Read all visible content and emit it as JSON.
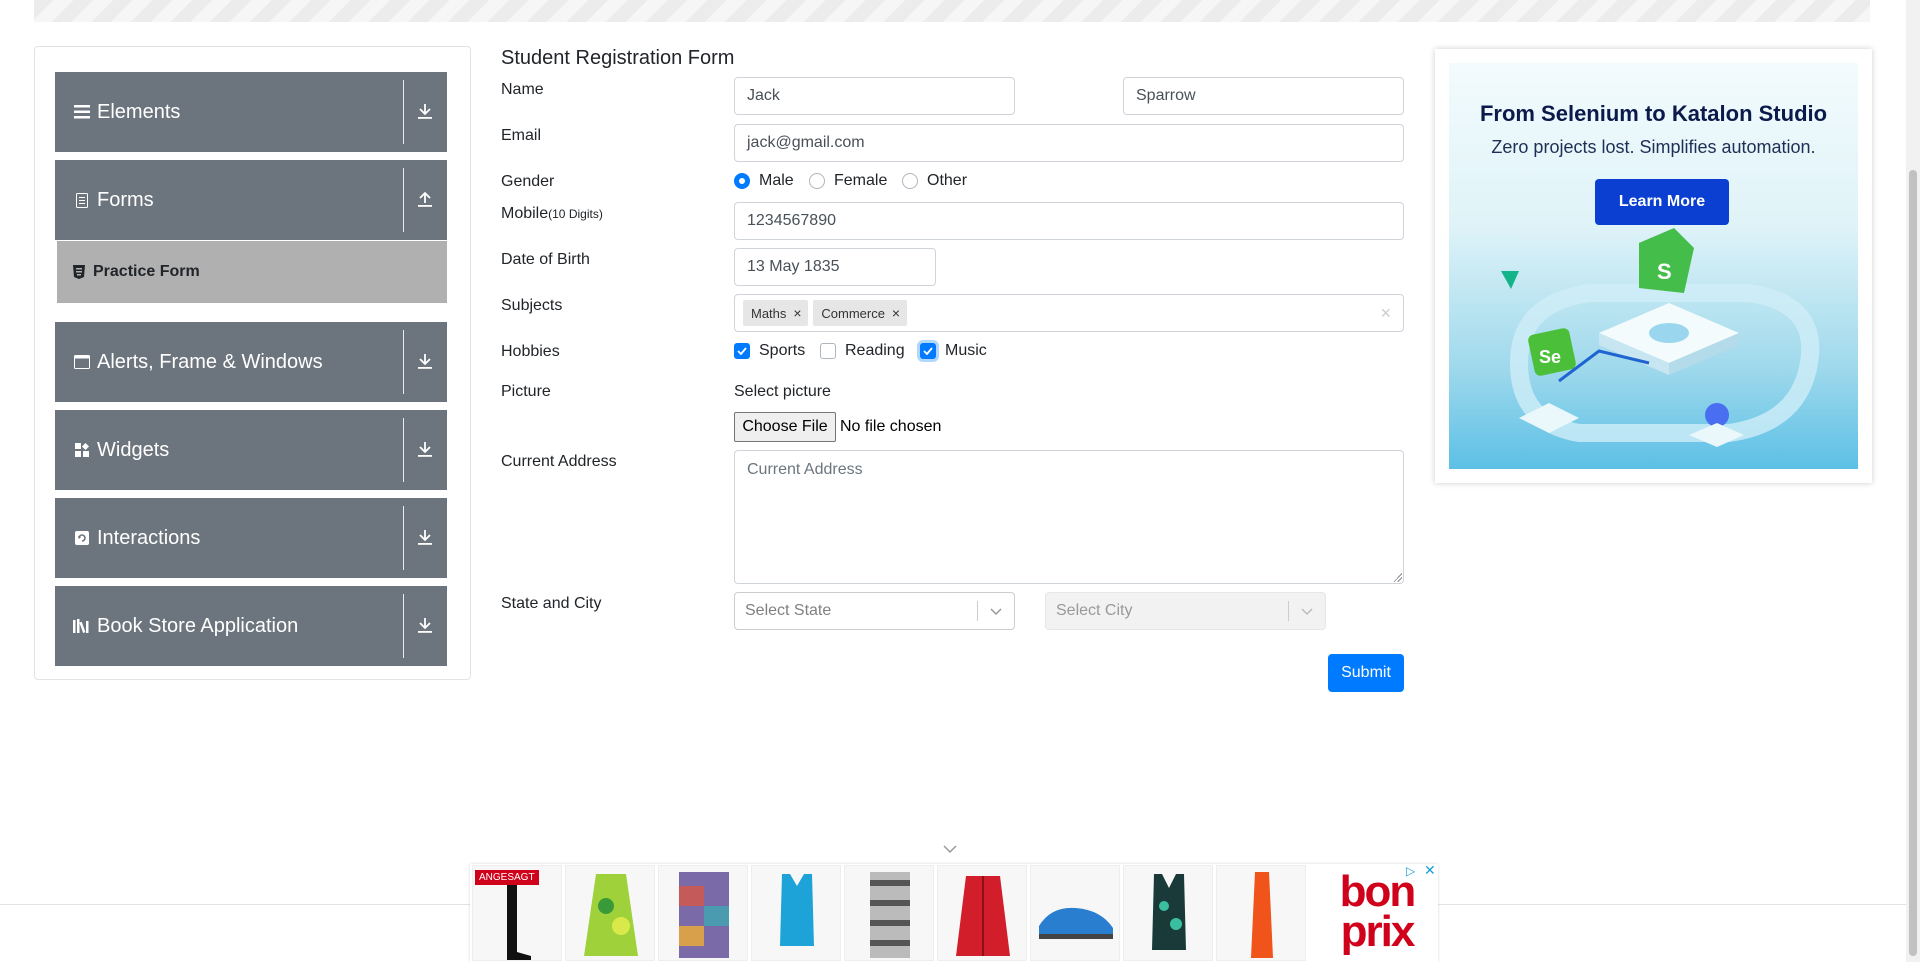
{
  "sidebar": {
    "groups": [
      {
        "label": "Elements",
        "icon": "hamburger-icon",
        "arrow": "download-icon"
      },
      {
        "label": "Forms",
        "icon": "document-icon",
        "arrow": "upload-icon"
      },
      {
        "label": "Alerts, Frame & Windows",
        "icon": "window-icon",
        "arrow": "download-icon"
      },
      {
        "label": "Widgets",
        "icon": "widgets-icon",
        "arrow": "download-icon"
      },
      {
        "label": "Interactions",
        "icon": "interactions-icon",
        "arrow": "download-icon"
      },
      {
        "label": "Book Store Application",
        "icon": "books-icon",
        "arrow": "download-icon"
      }
    ],
    "submenu": {
      "label": "Practice Form",
      "icon": "html5-icon"
    }
  },
  "form": {
    "title": "Student Registration Form",
    "name_label": "Name",
    "first_name": "Jack",
    "last_name": "Sparrow",
    "email_label": "Email",
    "email": "jack@gmail.com",
    "gender_label": "Gender",
    "gender_options": [
      "Male",
      "Female",
      "Other"
    ],
    "gender_selected": "Male",
    "mobile_label": "Mobile",
    "mobile_hint": "(10 Digits)",
    "mobile": "1234567890",
    "dob_label": "Date of Birth",
    "dob": "13 May 1835",
    "subjects_label": "Subjects",
    "subjects": [
      "Maths",
      "Commerce"
    ],
    "hobbies_label": "Hobbies",
    "hobbies": [
      {
        "label": "Sports",
        "checked": true
      },
      {
        "label": "Reading",
        "checked": false
      },
      {
        "label": "Music",
        "checked": true
      }
    ],
    "picture_label": "Picture",
    "select_picture": "Select picture",
    "choose_file": "Choose File",
    "no_file": "No file chosen",
    "address_label": "Current Address",
    "address_placeholder": "Current Address",
    "state_city_label": "State and City",
    "state_placeholder": "Select State",
    "city_placeholder": "Select City",
    "submit": "Submit"
  },
  "ad_right": {
    "title": "From Selenium to Katalon Studio",
    "subtitle": "Zero projects lost. Simplifies automation.",
    "button": "Learn More"
  },
  "ad_bottom": {
    "badge": "ANGESAGT",
    "brand": "bon prix",
    "products": [
      "boots",
      "green-tunic",
      "patchwork-dress",
      "blue-swimsuit",
      "striped-shorts",
      "red-jacket",
      "blue-sneaker",
      "patterned-swimsuit",
      "orange-skirt"
    ]
  },
  "colors": {
    "sidebar": "#6c757d",
    "submenu": "#b0b0b0",
    "primary": "#007bff",
    "brand_red": "#d0021b"
  }
}
